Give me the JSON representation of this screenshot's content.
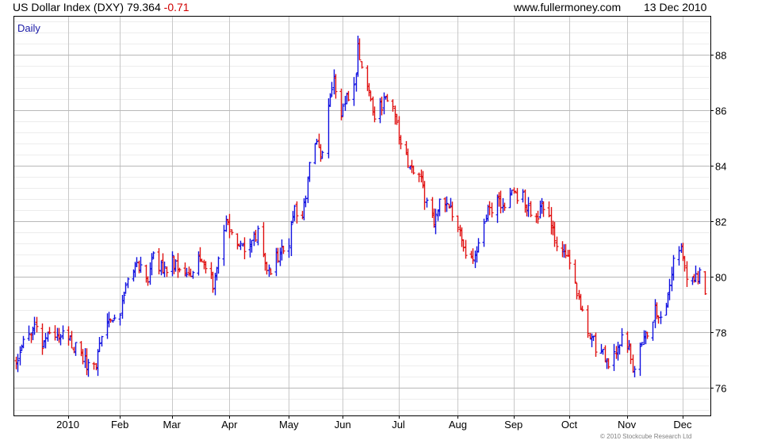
{
  "header": {
    "title": "US Dollar Index (DXY)",
    "last": "79.364",
    "change": "-0.71",
    "site": "www.fullermoney.com",
    "date": "13 Dec 2010"
  },
  "footer": {
    "copyright": "© 2010 Stockcube Research Ltd"
  },
  "colors": {
    "up": "#1010e0",
    "down": "#e01010",
    "grid": "#c8c8c8",
    "minor_grid": "#ececec"
  },
  "chart_data": {
    "type": "bar",
    "style": "ohlc",
    "period_label": "Daily",
    "x_range": [
      "2009-12-07",
      "2010-12-13"
    ],
    "ylim": [
      75,
      89.4
    ],
    "y_ticks": [
      76,
      78,
      80,
      82,
      84,
      86,
      88
    ],
    "x_ticks": [
      {
        "label": "2010",
        "date": "2010-01-04"
      },
      {
        "label": "Feb",
        "date": "2010-02-01"
      },
      {
        "label": "Mar",
        "date": "2010-03-01"
      },
      {
        "label": "Apr",
        "date": "2010-04-01"
      },
      {
        "label": "May",
        "date": "2010-05-03"
      },
      {
        "label": "Jun",
        "date": "2010-06-01"
      },
      {
        "label": "Jul",
        "date": "2010-07-01"
      },
      {
        "label": "Aug",
        "date": "2010-08-02"
      },
      {
        "label": "Sep",
        "date": "2010-09-01"
      },
      {
        "label": "Oct",
        "date": "2010-10-01"
      },
      {
        "label": "Nov",
        "date": "2010-11-01"
      },
      {
        "label": "Dec",
        "date": "2010-12-01"
      }
    ],
    "grid": true,
    "path": [
      [
        "2009-12-07",
        76.9
      ],
      [
        "2009-12-11",
        77.6
      ],
      [
        "2009-12-16",
        78.2
      ],
      [
        "2009-12-21",
        77.6
      ],
      [
        "2009-12-28",
        78.0
      ],
      [
        "2010-01-04",
        77.9
      ],
      [
        "2010-01-08",
        77.4
      ],
      [
        "2010-01-11",
        77.1
      ],
      [
        "2010-01-15",
        76.8
      ],
      [
        "2010-01-19",
        76.9
      ],
      [
        "2010-01-22",
        78.0
      ],
      [
        "2010-01-27",
        78.6
      ],
      [
        "2010-02-02",
        78.9
      ],
      [
        "2010-02-05",
        79.9
      ],
      [
        "2010-02-09",
        80.3
      ],
      [
        "2010-02-12",
        80.5
      ],
      [
        "2010-02-16",
        79.8
      ],
      [
        "2010-02-19",
        80.8
      ],
      [
        "2010-02-24",
        80.2
      ],
      [
        "2010-03-01",
        80.6
      ],
      [
        "2010-03-05",
        80.4
      ],
      [
        "2010-03-10",
        80.1
      ],
      [
        "2010-03-15",
        80.5
      ],
      [
        "2010-03-19",
        80.2
      ],
      [
        "2010-03-23",
        79.8
      ],
      [
        "2010-03-26",
        80.9
      ],
      [
        "2010-03-30",
        81.9
      ],
      [
        "2010-04-05",
        81.2
      ],
      [
        "2010-04-09",
        80.9
      ],
      [
        "2010-04-13",
        81.3
      ],
      [
        "2010-04-16",
        81.5
      ],
      [
        "2010-04-21",
        80.1
      ],
      [
        "2010-04-27",
        80.8
      ],
      [
        "2010-05-03",
        81.2
      ],
      [
        "2010-05-06",
        82.5
      ],
      [
        "2010-05-10",
        82.0
      ],
      [
        "2010-05-14",
        84.0
      ],
      [
        "2010-05-18",
        85.0
      ],
      [
        "2010-05-20",
        84.3
      ],
      [
        "2010-05-24",
        86.0
      ],
      [
        "2010-05-27",
        87.2
      ],
      [
        "2010-05-31",
        85.9
      ],
      [
        "2010-06-03",
        86.5
      ],
      [
        "2010-06-07",
        86.8
      ],
      [
        "2010-06-09",
        88.3
      ],
      [
        "2010-06-11",
        87.6
      ],
      [
        "2010-06-15",
        86.8
      ],
      [
        "2010-06-18",
        85.8
      ],
      [
        "2010-06-22",
        86.2
      ],
      [
        "2010-06-25",
        86.3
      ],
      [
        "2010-06-29",
        86.0
      ],
      [
        "2010-07-02",
        84.6
      ],
      [
        "2010-07-07",
        84.0
      ],
      [
        "2010-07-12",
        83.6
      ],
      [
        "2010-07-16",
        82.7
      ],
      [
        "2010-07-20",
        82.1
      ],
      [
        "2010-07-23",
        82.7
      ],
      [
        "2010-07-28",
        82.5
      ],
      [
        "2010-08-02",
        81.8
      ],
      [
        "2010-08-06",
        80.9
      ],
      [
        "2010-08-10",
        80.4
      ],
      [
        "2010-08-13",
        81.0
      ],
      [
        "2010-08-18",
        82.3
      ],
      [
        "2010-08-23",
        82.7
      ],
      [
        "2010-08-27",
        82.4
      ],
      [
        "2010-09-01",
        83.1
      ],
      [
        "2010-09-06",
        82.8
      ],
      [
        "2010-09-09",
        82.5
      ],
      [
        "2010-09-13",
        82.0
      ],
      [
        "2010-09-16",
        82.8
      ],
      [
        "2010-09-21",
        81.8
      ],
      [
        "2010-09-24",
        81.2
      ],
      [
        "2010-09-29",
        80.9
      ],
      [
        "2010-10-04",
        79.6
      ],
      [
        "2010-10-08",
        78.8
      ],
      [
        "2010-10-12",
        78.0
      ],
      [
        "2010-10-15",
        77.5
      ],
      [
        "2010-10-19",
        77.2
      ],
      [
        "2010-10-22",
        76.9
      ],
      [
        "2010-10-26",
        77.3
      ],
      [
        "2010-10-29",
        77.7
      ],
      [
        "2010-11-02",
        77.5
      ],
      [
        "2010-11-04",
        76.4
      ],
      [
        "2010-11-08",
        77.4
      ],
      [
        "2010-11-11",
        77.8
      ],
      [
        "2010-11-16",
        78.8
      ],
      [
        "2010-11-19",
        78.4
      ],
      [
        "2010-11-23",
        79.4
      ],
      [
        "2010-11-26",
        80.5
      ],
      [
        "2010-11-30",
        81.3
      ],
      [
        "2010-12-03",
        79.7
      ],
      [
        "2010-12-07",
        80.0
      ],
      [
        "2010-12-10",
        80.1
      ],
      [
        "2010-12-13",
        79.4
      ]
    ]
  }
}
